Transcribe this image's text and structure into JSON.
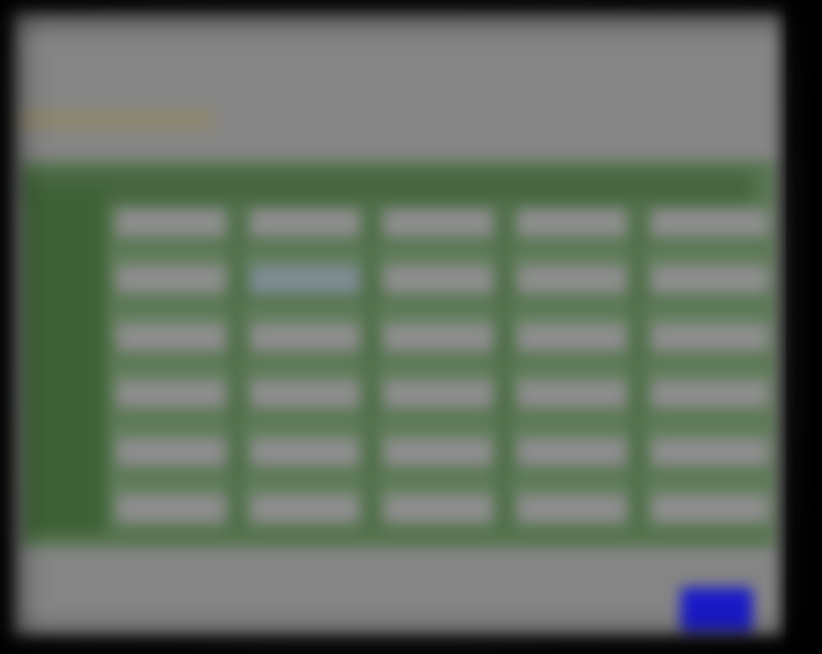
{
  "dialog": {
    "title": "",
    "subtitle": "",
    "tag": ""
  },
  "grid": {
    "row_labels": [
      "",
      "",
      "",
      "",
      "",
      ""
    ],
    "rows": [
      [
        "",
        "",
        "",
        "",
        ""
      ],
      [
        "",
        "",
        "",
        "",
        ""
      ],
      [
        "",
        "",
        "",
        "",
        ""
      ],
      [
        "",
        "",
        "",
        "",
        ""
      ],
      [
        "",
        "",
        "",
        "",
        ""
      ],
      [
        "",
        "",
        "",
        "",
        ""
      ]
    ],
    "selected_cell": [
      1,
      1
    ]
  },
  "footer": {
    "confirm_label": ""
  },
  "colors": {
    "panel": "#858585",
    "grid": "#56744f",
    "header": "#46663f",
    "cell": "#8e8e8e",
    "accent_button": "#1a1ac8",
    "tag": "#8c8570"
  }
}
